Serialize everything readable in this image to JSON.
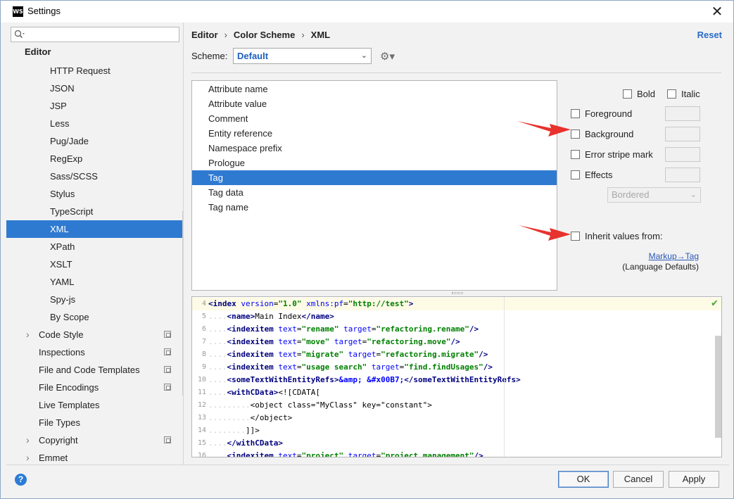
{
  "window": {
    "title": "Settings",
    "app_icon": "WS",
    "close_glyph": "✕"
  },
  "nav": {
    "search_placeholder": "",
    "items": [
      {
        "label": "Editor",
        "bold": true
      },
      {
        "label": "HTTP Request"
      },
      {
        "label": "JSON"
      },
      {
        "label": "JSP"
      },
      {
        "label": "Less"
      },
      {
        "label": "Pug/Jade"
      },
      {
        "label": "RegExp"
      },
      {
        "label": "Sass/SCSS"
      },
      {
        "label": "Stylus"
      },
      {
        "label": "TypeScript"
      },
      {
        "label": "XML",
        "selected": true
      },
      {
        "label": "XPath"
      },
      {
        "label": "XSLT"
      },
      {
        "label": "YAML"
      },
      {
        "label": "Spy-js"
      },
      {
        "label": "By Scope"
      },
      {
        "label": "Code Style",
        "expandable": true,
        "copy_icon": true
      },
      {
        "label": "Inspections",
        "copy_icon": true
      },
      {
        "label": "File and Code Templates",
        "copy_icon": true
      },
      {
        "label": "File Encodings",
        "copy_icon": true
      },
      {
        "label": "Live Templates"
      },
      {
        "label": "File Types"
      },
      {
        "label": "Copyright",
        "expandable": true,
        "copy_icon": true
      },
      {
        "label": "Emmet",
        "expandable": true
      }
    ]
  },
  "breadcrumb": {
    "part1": "Editor",
    "part2": "Color Scheme",
    "part3": "XML",
    "separator": "›"
  },
  "reset_label": "Reset",
  "scheme": {
    "label": "Scheme:",
    "value": "Default"
  },
  "elements": [
    {
      "label": "Attribute name"
    },
    {
      "label": "Attribute value"
    },
    {
      "label": "Comment"
    },
    {
      "label": "Entity reference"
    },
    {
      "label": "Namespace prefix"
    },
    {
      "label": "Prologue"
    },
    {
      "label": "Tag",
      "selected": true
    },
    {
      "label": "Tag data"
    },
    {
      "label": "Tag name"
    }
  ],
  "attributes": {
    "bold_label": "Bold",
    "italic_label": "Italic",
    "foreground_label": "Foreground",
    "background_label": "Background",
    "error_stripe_label": "Error stripe mark",
    "effects_label": "Effects",
    "effects_value": "Bordered",
    "inherit_label": "Inherit values from:",
    "inherit_link": "Markup→Tag",
    "inherit_sub": "(Language Defaults)"
  },
  "preview": {
    "lines": [
      {
        "n": "4",
        "current": true,
        "tokens": [
          [
            "tag",
            "<index "
          ],
          [
            "attr",
            "version"
          ],
          [
            "txt",
            "="
          ],
          [
            "val",
            "\"1.0\""
          ],
          [
            "txt",
            " "
          ],
          [
            "attr",
            "xmlns:pf"
          ],
          [
            "txt",
            "="
          ],
          [
            "val",
            "\"http://test\""
          ],
          [
            "tag",
            ">"
          ]
        ]
      },
      {
        "n": "5",
        "tokens": [
          [
            "dots",
            "...."
          ],
          [
            "tag",
            "<name"
          ],
          [
            "tag",
            ">"
          ],
          [
            "txt",
            "Main Index"
          ],
          [
            "tag",
            "</name>"
          ]
        ]
      },
      {
        "n": "6",
        "tokens": [
          [
            "dots",
            "...."
          ],
          [
            "tag",
            "<indexitem "
          ],
          [
            "attr",
            "text"
          ],
          [
            "txt",
            "="
          ],
          [
            "val",
            "\"rename\""
          ],
          [
            "txt",
            " "
          ],
          [
            "attr",
            "target"
          ],
          [
            "txt",
            "="
          ],
          [
            "val",
            "\"refactoring.rename\""
          ],
          [
            "tag",
            "/>"
          ]
        ]
      },
      {
        "n": "7",
        "tokens": [
          [
            "dots",
            "...."
          ],
          [
            "tag",
            "<indexitem "
          ],
          [
            "attr",
            "text"
          ],
          [
            "txt",
            "="
          ],
          [
            "val",
            "\"move\""
          ],
          [
            "txt",
            " "
          ],
          [
            "attr",
            "target"
          ],
          [
            "txt",
            "="
          ],
          [
            "val",
            "\"refactoring.move\""
          ],
          [
            "tag",
            "/>"
          ]
        ]
      },
      {
        "n": "8",
        "tokens": [
          [
            "dots",
            "...."
          ],
          [
            "tag",
            "<indexitem "
          ],
          [
            "attr",
            "text"
          ],
          [
            "txt",
            "="
          ],
          [
            "val",
            "\"migrate\""
          ],
          [
            "txt",
            " "
          ],
          [
            "attr",
            "target"
          ],
          [
            "txt",
            "="
          ],
          [
            "val",
            "\"refactoring.migrate\""
          ],
          [
            "tag",
            "/>"
          ]
        ]
      },
      {
        "n": "9",
        "tokens": [
          [
            "dots",
            "...."
          ],
          [
            "tag",
            "<indexitem "
          ],
          [
            "attr",
            "text"
          ],
          [
            "txt",
            "="
          ],
          [
            "val",
            "\"usage search\""
          ],
          [
            "txt",
            " "
          ],
          [
            "attr",
            "target"
          ],
          [
            "txt",
            "="
          ],
          [
            "val",
            "\"find.findUsages\""
          ],
          [
            "tag",
            "/>"
          ]
        ]
      },
      {
        "n": "10",
        "tokens": [
          [
            "dots",
            "...."
          ],
          [
            "tag",
            "<someTextWithEntityRefs>"
          ],
          [
            "ent",
            "&amp;"
          ],
          [
            "txt",
            " "
          ],
          [
            "ent",
            "&#x00B7;"
          ],
          [
            "tag",
            "</someTextWithEntityRefs>"
          ]
        ]
      },
      {
        "n": "11",
        "tokens": [
          [
            "dots",
            "...."
          ],
          [
            "tag",
            "<withCData>"
          ],
          [
            "txt",
            "<![CDATA["
          ]
        ]
      },
      {
        "n": "12",
        "tokens": [
          [
            "dots",
            "........."
          ],
          [
            "txt",
            "<object class=\"MyClass\" key=\"constant\">"
          ]
        ]
      },
      {
        "n": "13",
        "tokens": [
          [
            "dots",
            "........."
          ],
          [
            "txt",
            "</object>"
          ]
        ]
      },
      {
        "n": "14",
        "tokens": [
          [
            "dots",
            "........"
          ],
          [
            "txt",
            "]]>"
          ]
        ]
      },
      {
        "n": "15",
        "tokens": [
          [
            "dots",
            "...."
          ],
          [
            "tag",
            "</withCData>"
          ]
        ]
      },
      {
        "n": "16",
        "tokens": [
          [
            "dots",
            "...."
          ],
          [
            "tag",
            "<indexitem "
          ],
          [
            "attr",
            "text"
          ],
          [
            "txt",
            "="
          ],
          [
            "val",
            "\"project\""
          ],
          [
            "txt",
            " "
          ],
          [
            "attr",
            "target"
          ],
          [
            "txt",
            "="
          ],
          [
            "val",
            "\"project.management\""
          ],
          [
            "tag",
            "/>"
          ]
        ]
      }
    ]
  },
  "footer": {
    "help_glyph": "?",
    "ok_label": "OK",
    "cancel_label": "Cancel",
    "apply_label": "Apply"
  },
  "colors": {
    "selection": "#2f7ad1",
    "link": "#2a6acb",
    "annotation_arrow": "#e8322d"
  },
  "icons": {
    "search": "search-icon",
    "gear": "gear-icon",
    "close": "close-icon",
    "help": "help-icon",
    "copy": "copy-icon",
    "expand": "chevron-right-icon",
    "check": "check-icon"
  }
}
